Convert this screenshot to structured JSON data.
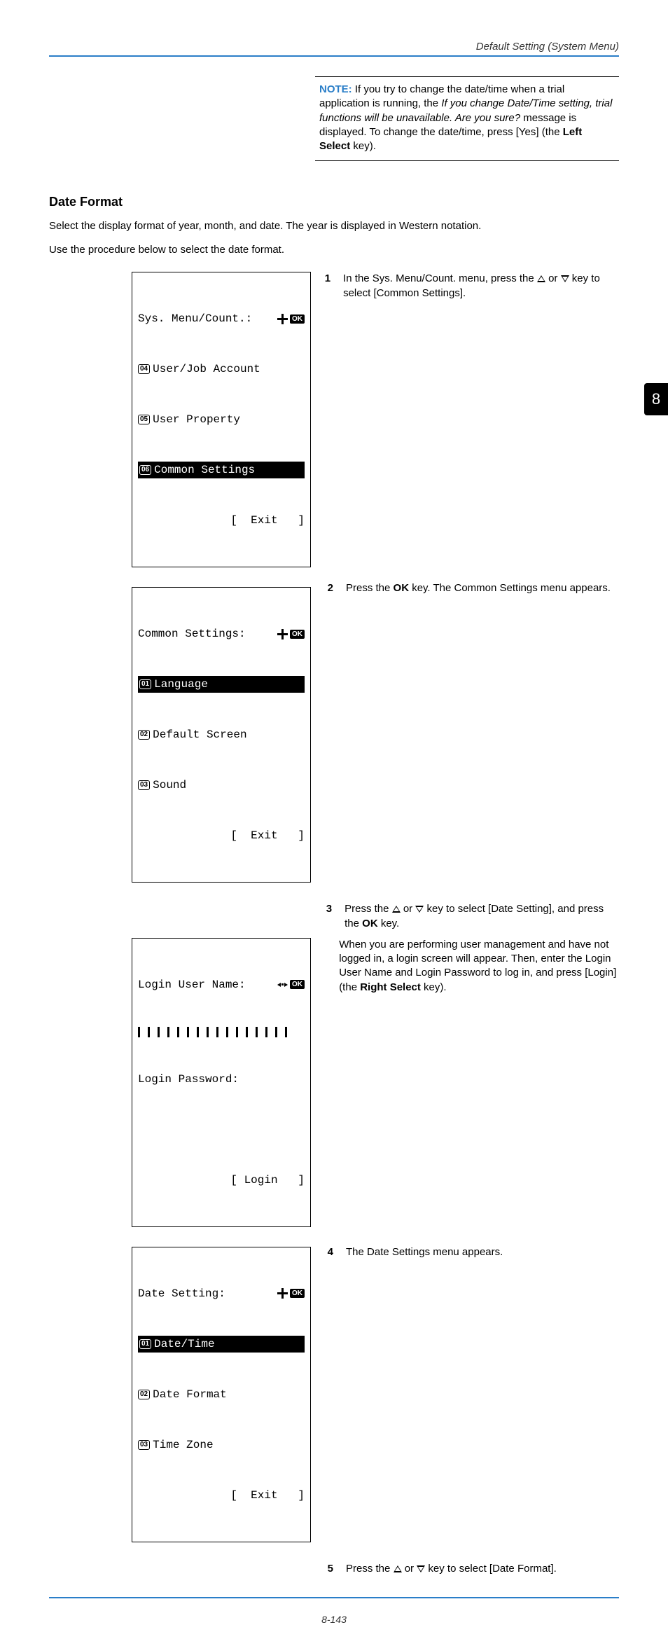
{
  "header_right": "Default Setting (System Menu)",
  "side_tab": "8",
  "footer": "8-143",
  "note": {
    "label": "NOTE:",
    "text_before_italic": " If you try to change the date/time when a trial application is running, the ",
    "italic": "If you change Date/Time setting, trial functions will be unavailable. Are you sure?",
    "text_after_italic": " message is displayed. To change the date/time, press [Yes] (the ",
    "bold_key": "Left Select",
    "tail": " key)."
  },
  "section_title": "Date Format",
  "intro1": "Select the display format of year, month, and date. The year is displayed in Western notation.",
  "intro2": "Use the procedure below to select the date format.",
  "screens": {
    "s1": {
      "title": "Sys. Menu/Count.:",
      "i4": "User/Job Account",
      "i5": "User Property",
      "i6": "Common Settings",
      "exit": "[  Exit   ]"
    },
    "s2": {
      "title": "Common Settings:",
      "i1": "Language",
      "i2": "Default Screen",
      "i3": "Sound",
      "exit": "[  Exit   ]"
    },
    "s3": {
      "l1": "Login User Name:",
      "l2": "Login Password:",
      "login": "[ Login   ]"
    },
    "s4": {
      "title": "Date Setting:",
      "i1": "Date/Time",
      "i2": "Date Format",
      "i3": "Time Zone",
      "exit": "[  Exit   ]"
    }
  },
  "steps": {
    "n1": "1",
    "t1a": "In the Sys. Menu/Count. menu, press the ",
    "t1b": " or ",
    "t1c": " key to select [Common Settings].",
    "n2": "2",
    "t2a": "Press the ",
    "t2ok": "OK",
    "t2b": " key. The Common Settings menu appears.",
    "n3": "3",
    "t3a": "Press the ",
    "t3b": " or ",
    "t3c": " key to select [Date Setting], and press the ",
    "t3ok": "OK",
    "t3d": " key.",
    "t3p2a": "When you are performing user management and have not logged in, a login screen will appear. Then, enter the Login User Name and Login Password to log in, and press [Login] (the ",
    "t3p2b": "Right Select",
    "t3p2c": " key).",
    "n4": "4",
    "t4": "The Date Settings menu appears.",
    "n5": "5",
    "t5a": "Press the ",
    "t5b": " or ",
    "t5c": " key to select [Date Format]."
  }
}
